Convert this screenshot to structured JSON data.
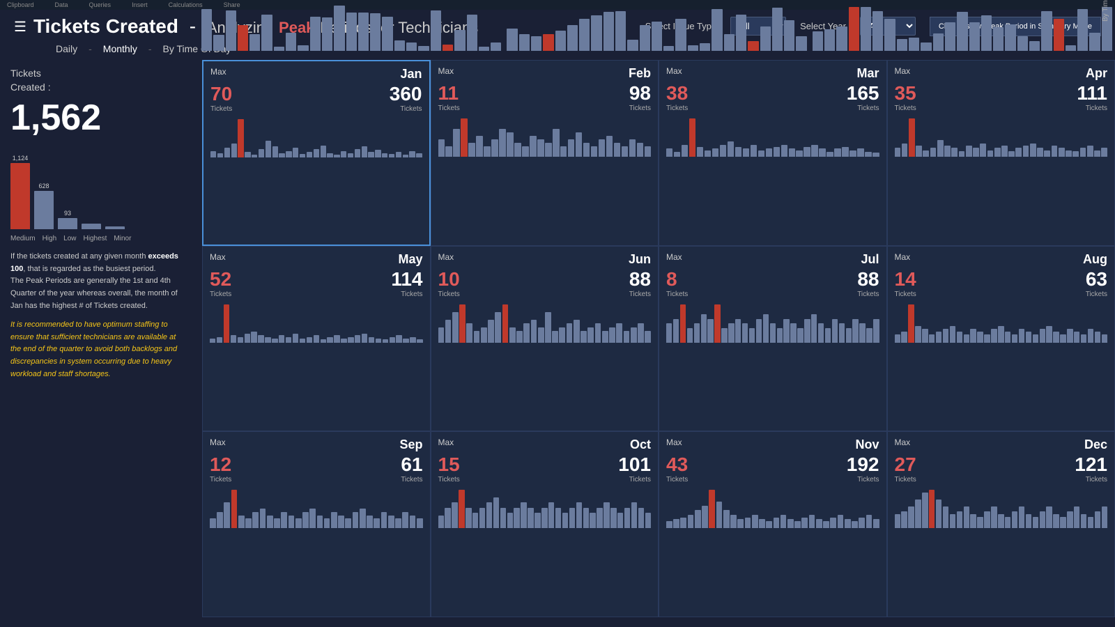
{
  "topbar": {
    "items": [
      "Clipboard",
      "Data",
      "Queries",
      "Insert",
      "Calculations",
      "Share"
    ]
  },
  "header": {
    "title": "Tickets Created",
    "dash": "-",
    "subtitle_analyzing": "Analyzing",
    "subtitle_peak": "Peak",
    "subtitle_rest": "Periods for Technicians",
    "hamburger": "☰"
  },
  "controls": {
    "issue_type_label": "Select Issue Type",
    "issue_type_value": "All",
    "year_label": "Select Year",
    "year_value": "All",
    "peak_btn": "Click to show Peak Period in Summary Mode"
  },
  "nav": {
    "items": [
      "Daily",
      "-",
      "Monthly",
      "-",
      "By Time Of Day"
    ]
  },
  "left": {
    "tickets_label": "Tickets\nCreated :",
    "tickets_count": "1,562",
    "bar_label_1124": "1,124",
    "categories": [
      "Medium",
      "High",
      "Low",
      "Highest",
      "Minor"
    ],
    "bar_628": "628",
    "bar_93": "93",
    "info_text_1": "If the tickets created at any given month",
    "info_exceeds": "exceeds 100",
    "info_text_2": ", that is regarded as the busiest period.\nThe Peak Periods are generally the 1st and 4th Quarter of the year whereas overall, the month of Jan has the highest # of Tickets created.",
    "recommendation": "It is recommended to have optimum staffing to ensure that sufficient technicians are available at the end of the quarter to avoid both backlogs and discrepancies in system occurring due to heavy workload and staff shortages."
  },
  "months": [
    {
      "name": "Jan",
      "max": 70,
      "total": 360,
      "highlighted": true
    },
    {
      "name": "Feb",
      "max": 11,
      "total": 98,
      "highlighted": false
    },
    {
      "name": "Mar",
      "max": 38,
      "total": 165,
      "highlighted": false
    },
    {
      "name": "Apr",
      "max": 35,
      "total": 111,
      "highlighted": false
    },
    {
      "name": "May",
      "max": 52,
      "total": 114,
      "highlighted": false
    },
    {
      "name": "Jun",
      "max": 10,
      "total": 88,
      "highlighted": false
    },
    {
      "name": "Jul",
      "max": 8,
      "total": 88,
      "highlighted": false
    },
    {
      "name": "Aug",
      "max": 14,
      "total": 63,
      "highlighted": false
    },
    {
      "name": "Sep",
      "max": 12,
      "total": 61,
      "highlighted": false
    },
    {
      "name": "Oct",
      "max": 15,
      "total": 101,
      "highlighted": false
    },
    {
      "name": "Nov",
      "max": 43,
      "total": 192,
      "highlighted": false
    },
    {
      "name": "Dec",
      "max": 27,
      "total": 121,
      "highlighted": false
    }
  ],
  "labels": {
    "max": "Max",
    "tickets": "Tickets"
  }
}
